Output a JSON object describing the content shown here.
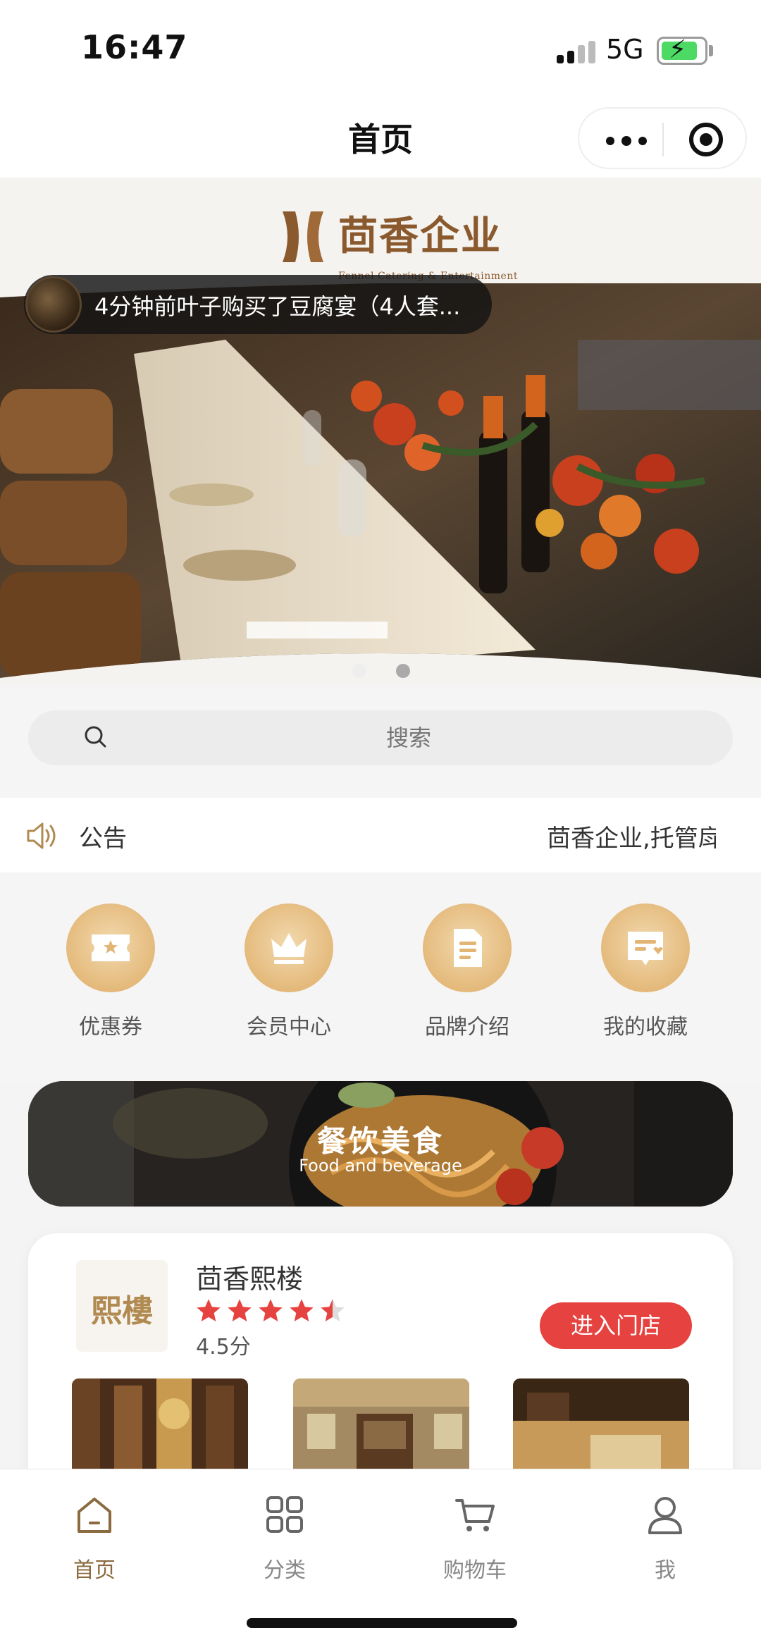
{
  "status_bar": {
    "time": "16:47",
    "network": "5G"
  },
  "nav": {
    "title": "首页"
  },
  "brand": {
    "name": "茴香企业",
    "subtitle": "Fennel Catering & Entertainment"
  },
  "banner": {
    "toast": "4分钟前叶子购买了豆腐宴（4人套...",
    "slide_count": 2,
    "active_slide": 2
  },
  "search": {
    "placeholder": "搜索"
  },
  "notice": {
    "label": "公告",
    "text": "茴香企业,托管戽"
  },
  "quick_links": [
    {
      "label": "优惠券",
      "icon": "coupon-icon"
    },
    {
      "label": "会员中心",
      "icon": "crown-icon"
    },
    {
      "label": "品牌介绍",
      "icon": "document-icon"
    },
    {
      "label": "我的收藏",
      "icon": "favorite-icon"
    }
  ],
  "food_banner": {
    "title": "餐饮美食",
    "subtitle": "Food and beverage"
  },
  "store": {
    "logo_text": "熙樓",
    "name": "茴香熙楼",
    "rating": 4.5,
    "score_text": "4.5分",
    "enter_label": "进入门店"
  },
  "tabbar": [
    {
      "label": "首页",
      "icon": "home-icon",
      "active": true
    },
    {
      "label": "分类",
      "icon": "category-icon",
      "active": false
    },
    {
      "label": "购物车",
      "icon": "cart-icon",
      "active": false
    },
    {
      "label": "我",
      "icon": "user-icon",
      "active": false
    }
  ],
  "colors": {
    "accent_brown": "#8a6a3e",
    "enter_red": "#e64340",
    "star_red": "#e64340",
    "gold": "#e2b574"
  }
}
